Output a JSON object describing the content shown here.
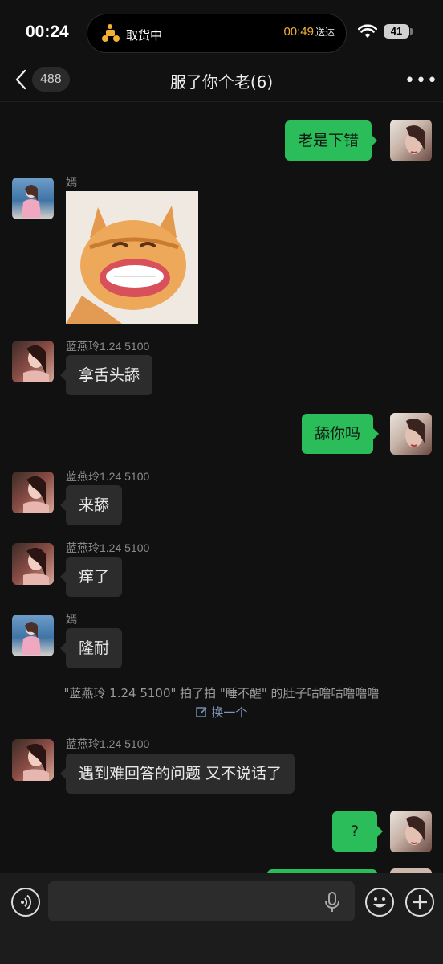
{
  "status_bar": {
    "time": "00:24",
    "activity": "取货中",
    "eta_time": "00:49",
    "eta_label": "送达",
    "battery": "41"
  },
  "nav": {
    "unread_count": "488",
    "chat_title": "服了你个老(6)",
    "more_label": "•••"
  },
  "messages": [
    {
      "direction": "out",
      "text": "老是下错"
    },
    {
      "direction": "in",
      "sender": "嫣",
      "type": "sticker",
      "sticker": "laughing-cat-sticker"
    },
    {
      "direction": "in",
      "sender": "蓝燕玲1.24 5100",
      "text": "拿舌头舔"
    },
    {
      "direction": "out",
      "text": "舔你吗"
    },
    {
      "direction": "in",
      "sender": "蓝燕玲1.24 5100",
      "text": "来舔"
    },
    {
      "direction": "in",
      "sender": "蓝燕玲1.24 5100",
      "text": "痒了"
    },
    {
      "direction": "in",
      "sender": "嫣",
      "text": "隆耐"
    },
    {
      "direction": "in",
      "sender": "蓝燕玲1.24 5100",
      "text": "遇到难回答的问题 又不说话了"
    },
    {
      "direction": "out",
      "text": "?"
    }
  ],
  "system_notice": {
    "text": "\"蓝燕玲 1.24 5100\" 拍了拍 \"睡不醒\" 的肚子咕噜咕噜噜噜",
    "action": "换一个"
  },
  "colors": {
    "background": "#111111",
    "outgoing_bubble": "#2bbd5a",
    "incoming_bubble": "#2c2c2c",
    "eta_accent": "#f2b134"
  }
}
